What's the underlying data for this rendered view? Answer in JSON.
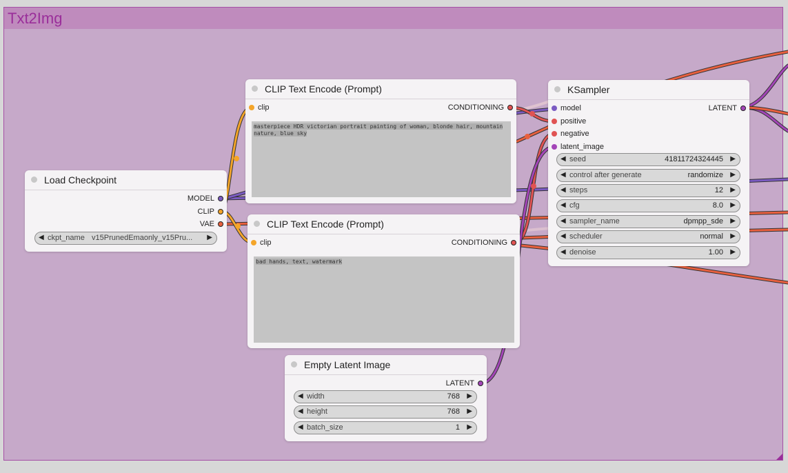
{
  "group": {
    "title": "Txt2Img"
  },
  "nodes": {
    "load_checkpoint": {
      "title": "Load Checkpoint",
      "outputs": [
        "MODEL",
        "CLIP",
        "VAE"
      ],
      "ckpt_name_label": "ckpt_name",
      "ckpt_name_value": "v15PrunedEmaonly_v15Pru..."
    },
    "clip_positive": {
      "title": "CLIP Text Encode (Prompt)",
      "input": "clip",
      "output": "CONDITIONING",
      "text": "masterpiece HDR victorian portrait painting of woman, blonde hair, mountain nature, blue sky"
    },
    "clip_negative": {
      "title": "CLIP Text Encode (Prompt)",
      "input": "clip",
      "output": "CONDITIONING",
      "text": "bad hands, text, watermark"
    },
    "ksampler": {
      "title": "KSampler",
      "inputs": [
        "model",
        "positive",
        "negative",
        "latent_image"
      ],
      "output": "LATENT",
      "widgets": [
        {
          "name": "seed",
          "value": "41811724324445"
        },
        {
          "name": "control after generate",
          "value": "randomize"
        },
        {
          "name": "steps",
          "value": "12"
        },
        {
          "name": "cfg",
          "value": "8.0"
        },
        {
          "name": "sampler_name",
          "value": "dpmpp_sde"
        },
        {
          "name": "scheduler",
          "value": "normal"
        },
        {
          "name": "denoise",
          "value": "1.00"
        }
      ]
    },
    "empty_latent": {
      "title": "Empty Latent Image",
      "output": "LATENT",
      "widgets": [
        {
          "name": "width",
          "value": "768"
        },
        {
          "name": "height",
          "value": "768"
        },
        {
          "name": "batch_size",
          "value": "1"
        }
      ]
    }
  },
  "colors": {
    "model": "#7b5bc2",
    "clip": "#f4a52a",
    "vae": "#e8603f",
    "conditioning": "#e05353",
    "latent": "#a345b7",
    "group_bg": "#c6a9c9",
    "group_title": "#9a2e9a"
  },
  "icons": {
    "arrow_left": "◀",
    "arrow_right": "▶"
  }
}
